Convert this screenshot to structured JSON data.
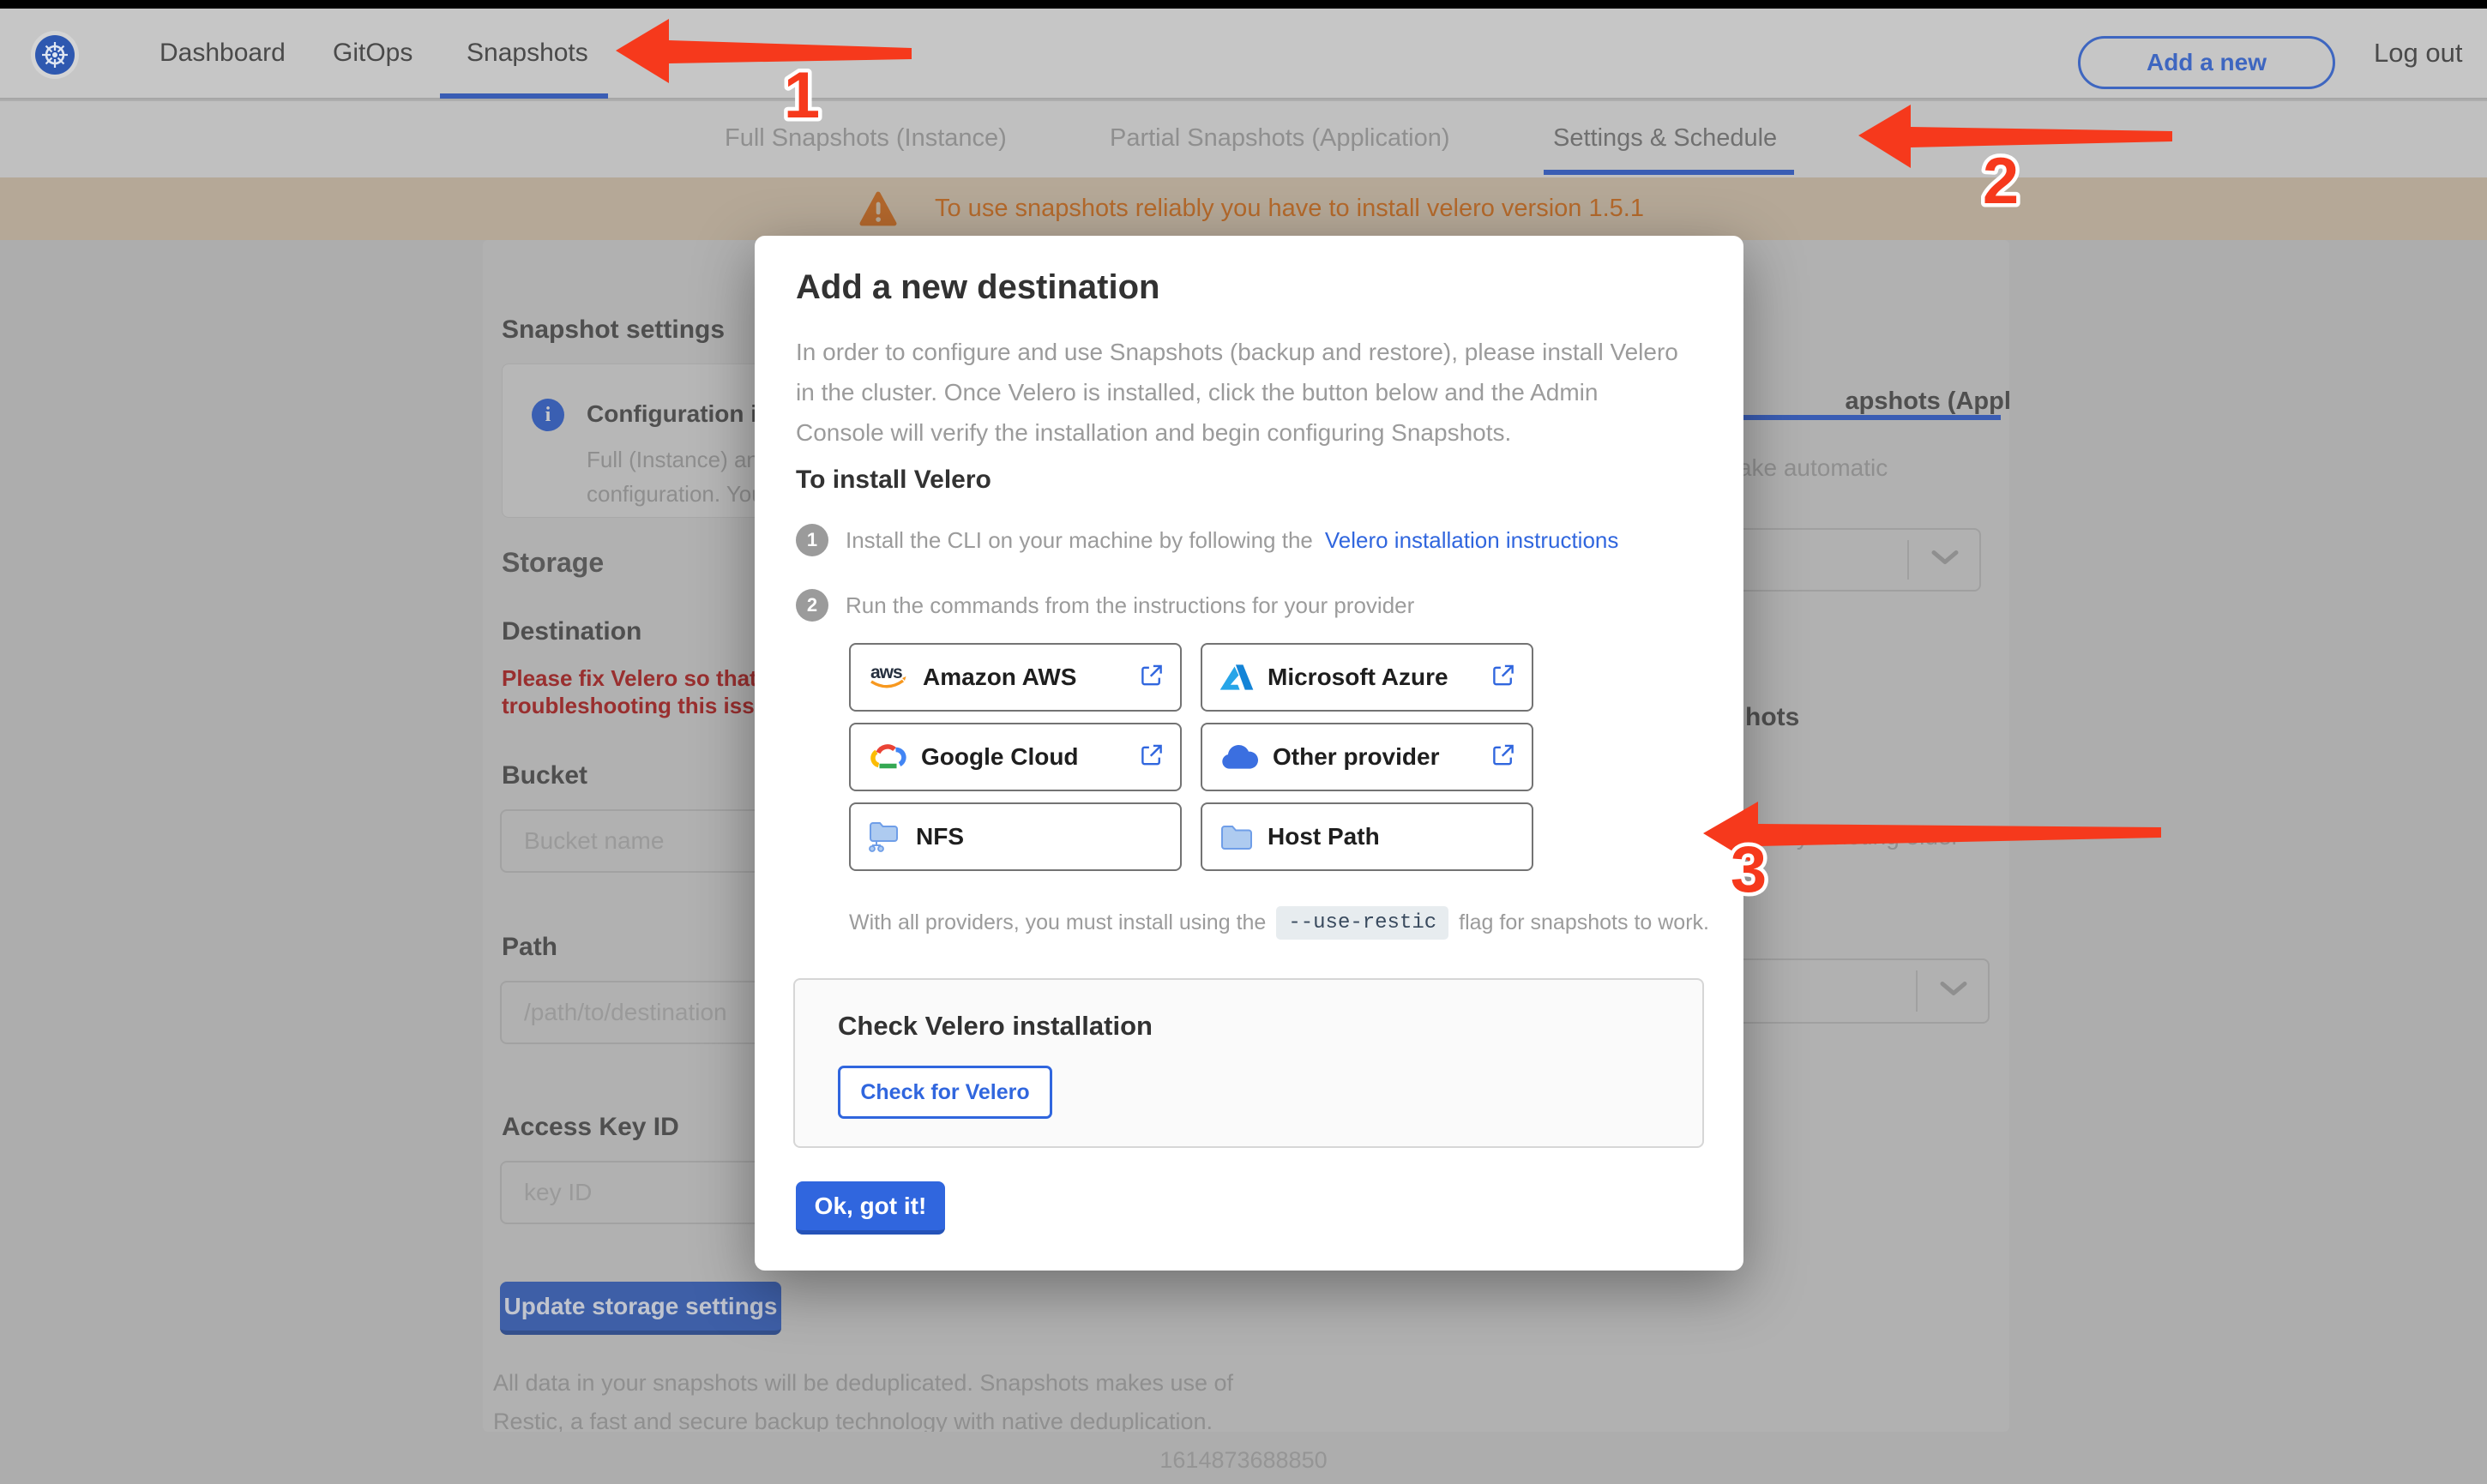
{
  "colors": {
    "accent_blue": "#3066de",
    "annotation_red": "#f6391c",
    "banner_orange": "#b4692b",
    "error_red": "#992f2f"
  },
  "topnav": {
    "items": [
      {
        "label": "Dashboard"
      },
      {
        "label": "GitOps"
      },
      {
        "label": "Snapshots"
      }
    ],
    "active": "Snapshots",
    "add_app_button": "Add a new application",
    "logout": "Log out"
  },
  "subnav": {
    "tabs": [
      {
        "label": "Full Snapshots (Instance)"
      },
      {
        "label": "Partial Snapshots (Application)"
      },
      {
        "label": "Settings & Schedule"
      }
    ],
    "active": "Settings & Schedule"
  },
  "banner": {
    "text": "To use snapshots reliably you have to install velero version 1.5.1"
  },
  "settings_panel": {
    "heading": "Snapshot settings",
    "info_title": "Configuration is sh",
    "info_line1": "Full (Instance) and Parti",
    "info_line2": "configuration. Your stor",
    "storage_heading": "Storage",
    "destination_heading": "Destination",
    "error_line1": "Please fix Velero so that th",
    "error_line2": "troubleshooting this issue",
    "bucket_label": "Bucket",
    "bucket_placeholder": "Bucket name",
    "path_label": "Path",
    "path_placeholder": "/path/to/destination",
    "access_key_label": "Access Key ID",
    "access_key_placeholder": "key ID",
    "update_button": "Update storage settings",
    "dedupe_line1": "All data in your snapshots will be deduplicated. Snapshots makes use of",
    "dedupe_line2": "Restic, a fast and secure backup technology with native deduplication."
  },
  "right_panel": {
    "partial_tab": "apshots (Application)",
    "schedule_hint": "to take automatic",
    "heading_fragment": "hots",
    "retention_hint": "matically deleting older"
  },
  "modal": {
    "title": "Add a new destination",
    "paragraph": "In order to configure and use Snapshots (backup and restore), please install Velero in the cluster. Once Velero is installed, click the button below and the Admin Console will verify the installation and begin configuring Snapshots.",
    "install_heading": "To install Velero",
    "step1_number": "1",
    "step1_text": "Install the CLI on your machine by following the",
    "step1_link": "Velero installation instructions",
    "step2_number": "2",
    "step2_text": "Run the commands from the instructions for your provider",
    "providers": [
      {
        "name": "Amazon AWS",
        "external": true
      },
      {
        "name": "Microsoft Azure",
        "external": true
      },
      {
        "name": "Google Cloud",
        "external": true
      },
      {
        "name": "Other provider",
        "external": true
      },
      {
        "name": "NFS",
        "external": false
      },
      {
        "name": "Host Path",
        "external": false
      }
    ],
    "restic_prefix": "With all providers, you must install using the",
    "restic_code": "--use-restic",
    "restic_suffix": "flag for snapshots to work.",
    "check_heading": "Check Velero installation",
    "check_button": "Check for Velero",
    "ok_button": "Ok, got it!"
  },
  "annotations": {
    "step1": "1",
    "step2": "2",
    "step3": "3"
  },
  "footer": {
    "timestamp": "1614873688850"
  }
}
